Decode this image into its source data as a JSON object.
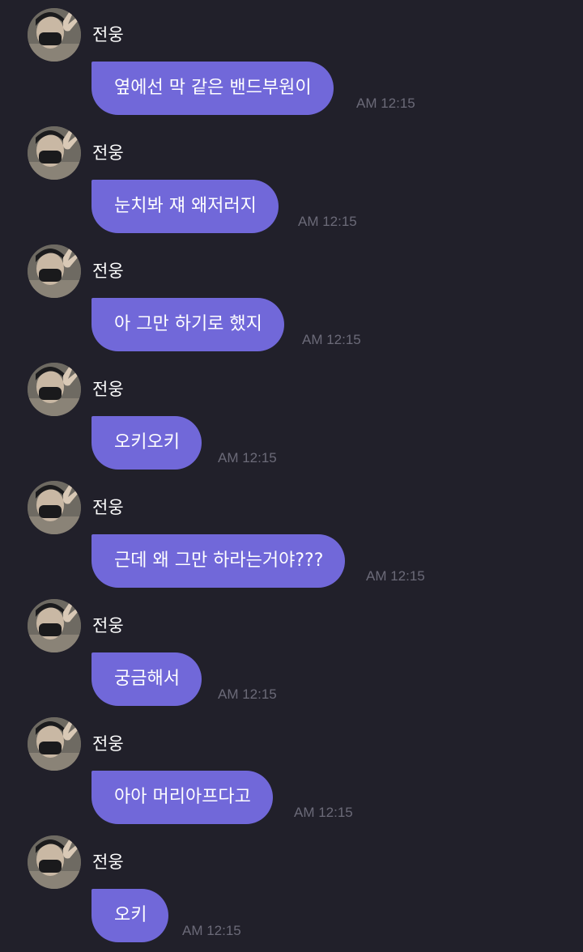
{
  "chat": {
    "messages": [
      {
        "sender": "전웅",
        "text": "옆에선 막 같은 밴드부원이",
        "time": "AM 12:15"
      },
      {
        "sender": "전웅",
        "text": "눈치봐 쟤 왜저러지",
        "time": "AM 12:15"
      },
      {
        "sender": "전웅",
        "text": "아 그만 하기로 했지",
        "time": "AM 12:15"
      },
      {
        "sender": "전웅",
        "text": "오키오키",
        "time": "AM 12:15"
      },
      {
        "sender": "전웅",
        "text": "근데 왜 그만 하라는거야???",
        "time": "AM 12:15"
      },
      {
        "sender": "전웅",
        "text": "궁금해서",
        "time": "AM 12:15"
      },
      {
        "sender": "전웅",
        "text": "아아 머리아프다고",
        "time": "AM 12:15"
      },
      {
        "sender": "전웅",
        "text": "오키",
        "time": "AM 12:15"
      }
    ]
  },
  "colors": {
    "background": "#21202a",
    "bubble": "#7168d9",
    "time_text": "#6b6a78",
    "sender_text": "#ffffff"
  },
  "icons": {
    "avatar": "profile-photo-avatar"
  }
}
